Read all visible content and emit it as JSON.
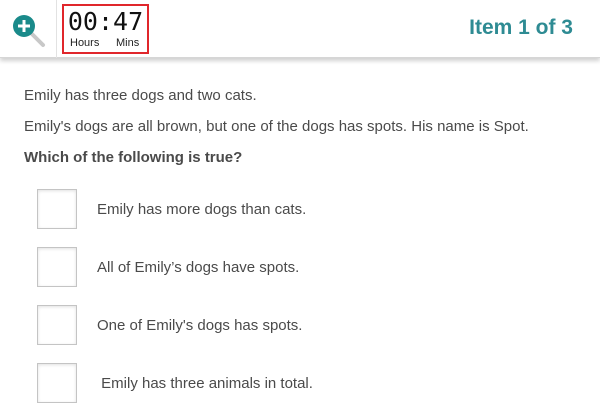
{
  "header": {
    "zoom_icon": "zoom-in-icon",
    "timer": {
      "hours": "00",
      "separator": ":",
      "minutes": "47",
      "hours_label": "Hours",
      "mins_label": "Mins",
      "border_color": "#e0262b"
    },
    "item_counter": "Item 1 of 3",
    "accent_color": "#2e8b93"
  },
  "stem": {
    "lines": [
      "Emily has three dogs and two cats.",
      "Emily's dogs are all brown, but one of the dogs has spots. His name is Spot."
    ],
    "question": "Which of the following is true?"
  },
  "options": [
    {
      "label": "Emily has more dogs than cats.",
      "checked": false
    },
    {
      "label": "All of Emily’s dogs have spots.",
      "checked": false
    },
    {
      "label": "One of Emily's dogs has spots.",
      "checked": false
    },
    {
      "label": " Emily has three animals in total.",
      "checked": false
    }
  ]
}
